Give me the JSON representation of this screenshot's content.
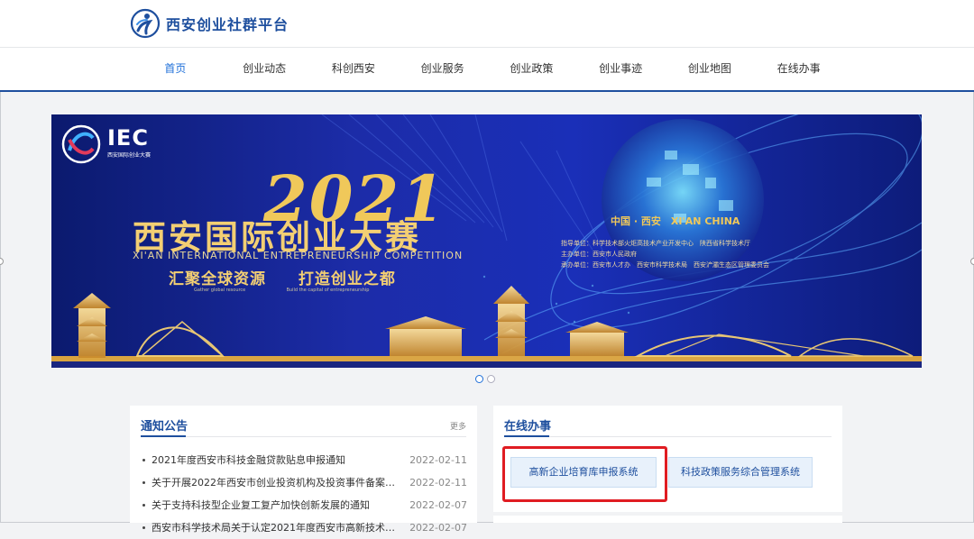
{
  "header": {
    "site_name": "西安创业社群平台",
    "logo_icon": "runner-logo-icon",
    "accent_color": "#1e4f9e"
  },
  "nav": {
    "items": [
      {
        "label": "首页",
        "active": true
      },
      {
        "label": "创业动态"
      },
      {
        "label": "科创西安"
      },
      {
        "label": "创业服务"
      },
      {
        "label": "创业政策"
      },
      {
        "label": "创业事迹"
      },
      {
        "label": "创业地图"
      },
      {
        "label": "在线办事"
      }
    ]
  },
  "banner": {
    "logo_text": "IEC",
    "logo_sub": "西安国际创业大赛",
    "year": "2021",
    "title": "西安国际创业大赛",
    "title_en": "XI'AN INTERNATIONAL ENTREPRENEURSHIP COMPETITION",
    "slogan_left": "汇聚全球资源",
    "slogan_right": "打造创业之都",
    "slogan_left_en": "Gather global resource",
    "slogan_right_en": "Build the capital of entrepreneurship",
    "china_line": "中国 · 西安　XI'AN CHINA",
    "org_lines": [
      "指导单位：科学技术部火炬高技术产业开发中心　陕西省科学技术厅",
      "主办单位：西安市人民政府",
      "承办单位：西安市人才办　西安市科学技术局　西安浐灞生态区管理委员会"
    ],
    "slides": 2,
    "active_slide": 0
  },
  "notice": {
    "title": "通知公告",
    "more": "更多",
    "items": [
      {
        "title": "2021年度西安市科技金融贷款贴息申报通知",
        "date": "2022-02-11"
      },
      {
        "title": "关于开展2022年西安市创业投资机构及投资事件备案…",
        "date": "2022-02-11"
      },
      {
        "title": "关于支持科技型企业复工复产加快创新发展的通知",
        "date": "2022-02-07"
      },
      {
        "title": "西安市科学技术局关于认定2021年度西安市高新技术…",
        "date": "2022-02-07"
      }
    ]
  },
  "online": {
    "title": "在线办事",
    "systems": [
      {
        "label": "高新企业培育库申报系统",
        "highlighted": true
      },
      {
        "label": "科技政策服务综合管理系统"
      }
    ],
    "highlight_color": "#e01c22"
  }
}
